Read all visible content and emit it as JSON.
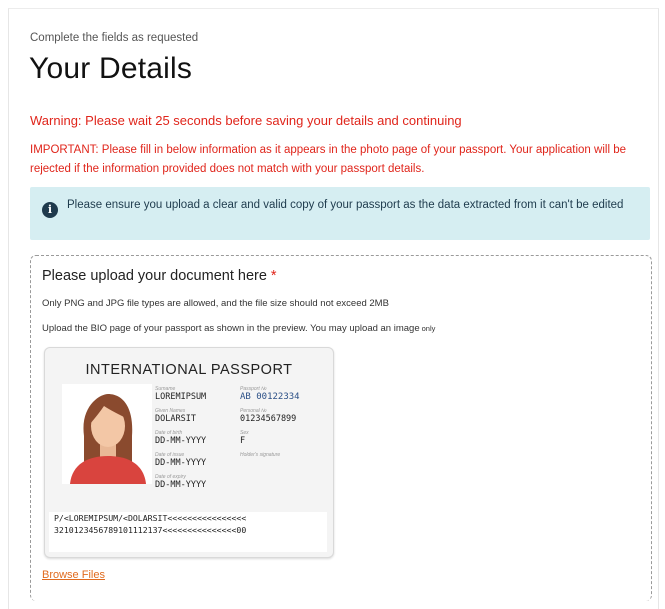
{
  "header": {
    "subtitle": "Complete the fields as requested",
    "title": "Your Details"
  },
  "warning": "Warning: Please wait 25 seconds before saving your details and continuing",
  "important": "IMPORTANT: Please fill in below information as it appears in the photo page of your passport. Your application will be rejected if the information provided does not match with your passport details.",
  "info": {
    "icon": "info-icon",
    "text": "Please ensure you upload a clear and valid copy of your passport as the data extracted from it can't be edited"
  },
  "upload": {
    "heading": "Please upload your document here",
    "required_mark": "*",
    "note_types": "Only PNG and JPG file types are allowed, and the file size should not exceed 2MB",
    "note_preview": "Upload the BIO page of your passport as shown in the preview. You may upload an image",
    "note_only": "only",
    "browse_label": "Browse Files"
  },
  "passport": {
    "header": "INTERNATIONAL PASSPORT",
    "surname_label": "Surname",
    "surname": "LOREMIPSUM",
    "given_label": "Given Names",
    "given": "DOLARSIT",
    "dob_label": "Date of birth",
    "dob": "DD-MM-YYYY",
    "issue_label": "Date of issue",
    "issue": "DD-MM-YYYY",
    "expiry_label": "Date of expiry",
    "expiry": "DD-MM-YYYY",
    "passport_no_label": "Passport №",
    "passport_no": "AB 00122334",
    "personal_no_label": "Personal №",
    "personal_no": "01234567899",
    "sex_label": "Sex",
    "sex": "F",
    "signature_label": "Holder's signature",
    "mrz_line1": "P/<LOREMIPSUM/<DOLARSIT<<<<<<<<<<<<<<<<",
    "mrz_line2": "3210123456789101112137<<<<<<<<<<<<<<<00"
  },
  "colors": {
    "warning": "#e0251b",
    "info_bg": "#d6eef2",
    "info_icon": "#1f3a4d",
    "link": "#e06b1f",
    "passport_number": "#2a4f86"
  }
}
